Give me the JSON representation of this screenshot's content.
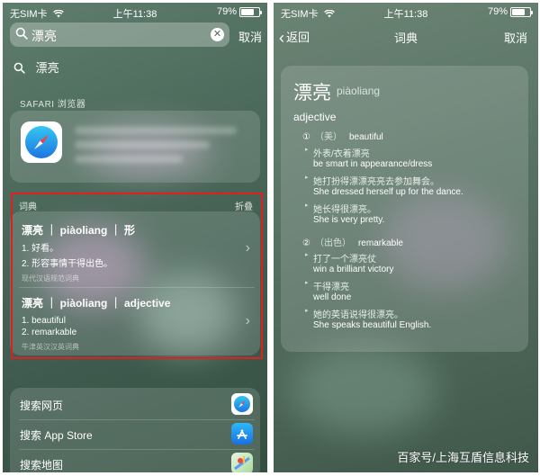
{
  "status_bar": {
    "carrier": "无SIM卡",
    "time": "上午11:38",
    "battery": "79%"
  },
  "left": {
    "search": {
      "query": "漂亮",
      "cancel_label": "取消"
    },
    "suggestion": {
      "text": "漂亮"
    },
    "safari_section_label": "SAFARI 浏览器",
    "dictionary_section": {
      "label": "词典",
      "fold_label": "折叠",
      "entries": [
        {
          "head": "漂亮 ｜ piàoliang ｜ 形",
          "lines": [
            "1. 好看。",
            "2. 形容事情干得出色。"
          ],
          "source": "现代汉语规范词典"
        },
        {
          "head": "漂亮 ｜ piàoliang ｜ adjective",
          "lines": [
            "1. beautiful",
            "2. remarkable"
          ],
          "source": "牛津英汉汉英词典"
        }
      ]
    },
    "actions": [
      {
        "label": "搜索网页",
        "icon": "safari-icon"
      },
      {
        "label": "搜索 App Store",
        "icon": "app-store-icon"
      },
      {
        "label": "搜索地图",
        "icon": "maps-icon"
      }
    ]
  },
  "right": {
    "nav": {
      "back_label": "返回",
      "title": "词典",
      "cancel_label": "取消"
    },
    "entry": {
      "word": "漂亮",
      "pinyin": "piàoliang",
      "part_of_speech": "adjective",
      "senses": [
        {
          "number": "①",
          "tag": "（美）",
          "gloss": "beautiful",
          "examples": [
            {
              "cn": "外表/衣着漂亮",
              "en": "be smart in appearance/dress"
            },
            {
              "cn": "她打扮得漂漂亮亮去参加舞会。",
              "en": "She dressed herself up for the dance."
            },
            {
              "cn": "她长得很漂亮。",
              "en": "She is very pretty."
            }
          ]
        },
        {
          "number": "②",
          "tag": "（出色）",
          "gloss": "remarkable",
          "examples": [
            {
              "cn": "打了一个漂亮仗",
              "en": "win a brilliant victory"
            },
            {
              "cn": "干得漂亮",
              "en": "well done"
            },
            {
              "cn": "她的英语说得很漂亮。",
              "en": "She speaks beautiful English."
            }
          ]
        }
      ]
    }
  },
  "watermark": "百家号/上海互盾信息科技",
  "colors": {
    "highlight_border": "#e02020",
    "safari_blue": "#1e74e0"
  }
}
